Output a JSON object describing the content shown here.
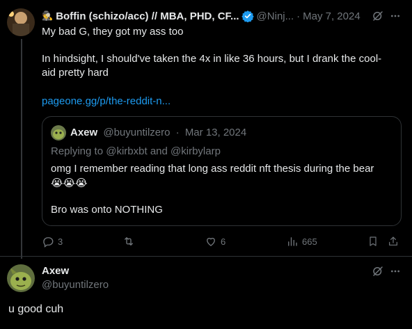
{
  "main_tweet": {
    "author_emoji": "🕵️",
    "author_name": "Boffin (schizo/acc) // MBA, PHD, CF...",
    "handle": "@Ninj...",
    "separator": "·",
    "date": "May 7, 2024",
    "line1": "My bad G, they got my ass too",
    "line2": "In hindsight, I should've taken the 4x in like 36 hours, but I drank the cool-",
    "line3": "aid pretty hard",
    "link": "pageone.gg/p/the-reddit-n...",
    "icons": {
      "verified": "verified-badge-icon",
      "grok": "grok-icon",
      "more": "more-icon"
    },
    "colors": {
      "link": "#1d9bf0",
      "verified": "#1d9bf0",
      "muted": "#71767b"
    }
  },
  "quoted_tweet": {
    "author_name": "Axew",
    "handle": "@buyuntilzero",
    "separator": "·",
    "date": "Mar 13, 2024",
    "replying_prefix": "Replying to",
    "replying_user1": "@kirbxbt",
    "replying_and": "and",
    "replying_user2": "@kirbylarp",
    "body_line1": "omg I remember reading that long ass reddit nft thesis during the bear",
    "emojis": "😭😭😭",
    "body_line2": "Bro was onto NOTHING"
  },
  "actions": {
    "replies": "3",
    "retweets": "",
    "likes": "6",
    "views": "665",
    "icons": [
      "reply-icon",
      "retweet-icon",
      "like-icon",
      "views-icon",
      "bookmark-icon",
      "share-icon"
    ]
  },
  "reply_tweet": {
    "author_name": "Axew",
    "handle": "@buyuntilzero",
    "text": "u good cuh",
    "icons": {
      "grok": "grok-icon",
      "more": "more-icon"
    }
  }
}
